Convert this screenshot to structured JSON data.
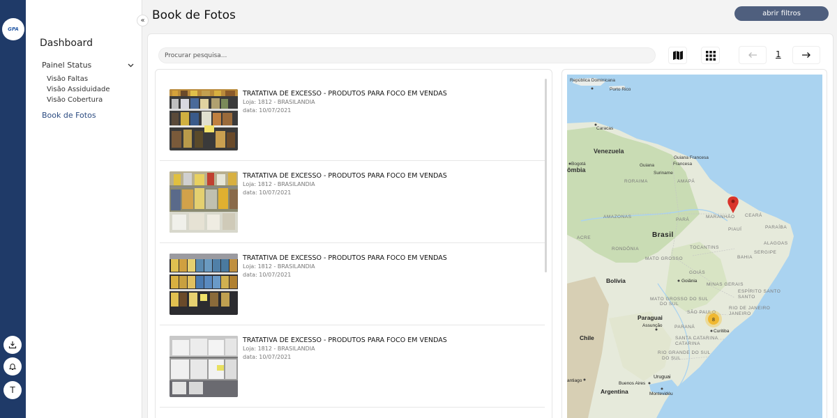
{
  "rail": {
    "logo_text": "GPA",
    "buttons": [
      {
        "icon": "download-icon"
      },
      {
        "icon": "bell-icon"
      },
      {
        "icon": "user-initial",
        "label": "T"
      }
    ]
  },
  "sidebar": {
    "heading": "Dashboard",
    "group_label": "Painel Status",
    "sub_items": [
      "Visão Faltas",
      "Visão Assiduidade",
      "Visão Cobertura"
    ],
    "active_item": "Book de Fotos"
  },
  "header": {
    "title": "Book de Fotos",
    "filters_button": "abrir filtros"
  },
  "toolbar": {
    "search_placeholder": "Procurar pesquisa...",
    "map_view_icon": "map-icon",
    "grid_view_icon": "grid-icon",
    "page_number": "1",
    "prev_icon": "arrow-left-icon",
    "next_icon": "arrow-right-icon"
  },
  "items": [
    {
      "title": "TRATATIVA DE EXCESSO - PRODUTOS PARA FOCO EM VENDAS",
      "store": "Loja: 1812 - BRASILANDIA",
      "date": "data: 10/07/2021"
    },
    {
      "title": "TRATATIVA DE EXCESSO - PRODUTOS PARA FOCO EM VENDAS",
      "store": "Loja: 1812 - BRASILANDIA",
      "date": "data: 10/07/2021"
    },
    {
      "title": "TRATATIVA DE EXCESSO - PRODUTOS PARA FOCO EM VENDAS",
      "store": "Loja: 1812 - BRASILANDIA",
      "date": "data: 10/07/2021"
    },
    {
      "title": "TRATATIVA DE EXCESSO - PRODUTOS PARA FOCO EM VENDAS",
      "store": "Loja: 1812 - BRASILANDIA",
      "date": "data: 10/07/2021"
    }
  ],
  "map": {
    "labels": {
      "rep_dom": "República Dominicana",
      "porto_rico": "Porto Rico",
      "caracas": "Caracas",
      "venezuela": "Venezuela",
      "bogota": "Bogotá",
      "colombia": "ômbia",
      "guiana": "Guiana",
      "guiana_fr": "Guiana Francesa",
      "suriname": "Suriname",
      "roraima": "RORAIMA",
      "amapa": "AMAPÁ",
      "amazonas": "AMAZONAS",
      "para": "PARÁ",
      "maranhao": "MARANHÃO",
      "ceara": "CEARÁ",
      "piaui": "PIAUÍ",
      "paraiba": "PARAÍBA",
      "brasil": "Brasil",
      "acre": "ACRE",
      "rondonia": "RONDÔNIA",
      "tocantins": "TOCANTINS",
      "alagoas": "ALAGOAS",
      "sergipe": "SERGIPE",
      "mato_grosso": "MATO GROSSO",
      "bahia": "BAHIA",
      "goias": "GOIÁS",
      "goiania": "Goiânia",
      "bolivia": "Bolívia",
      "minas": "MINAS GERAIS",
      "ms": "MATO GROSSO DO SUL",
      "espirito": "ESPÍRITO SANTO",
      "sao_paulo": "SÃO PAULO",
      "rio": "RIO DE JANEIRO",
      "paraguai": "Paraguai",
      "assuncao": "Assunção",
      "parana": "PARANÁ",
      "curitiba": "Curitiba",
      "chile": "Chile",
      "santa_catarina": "SANTA CATARINA",
      "rs": "RIO GRANDE DO SUL",
      "santiago": "antiago",
      "uruguai": "Uruguai",
      "buenos_aires": "Buenos Aires",
      "montevideu": "Montevidéu",
      "argentina": "Argentina"
    },
    "cluster_count": "8",
    "marker_icon": "map-pin-icon"
  }
}
